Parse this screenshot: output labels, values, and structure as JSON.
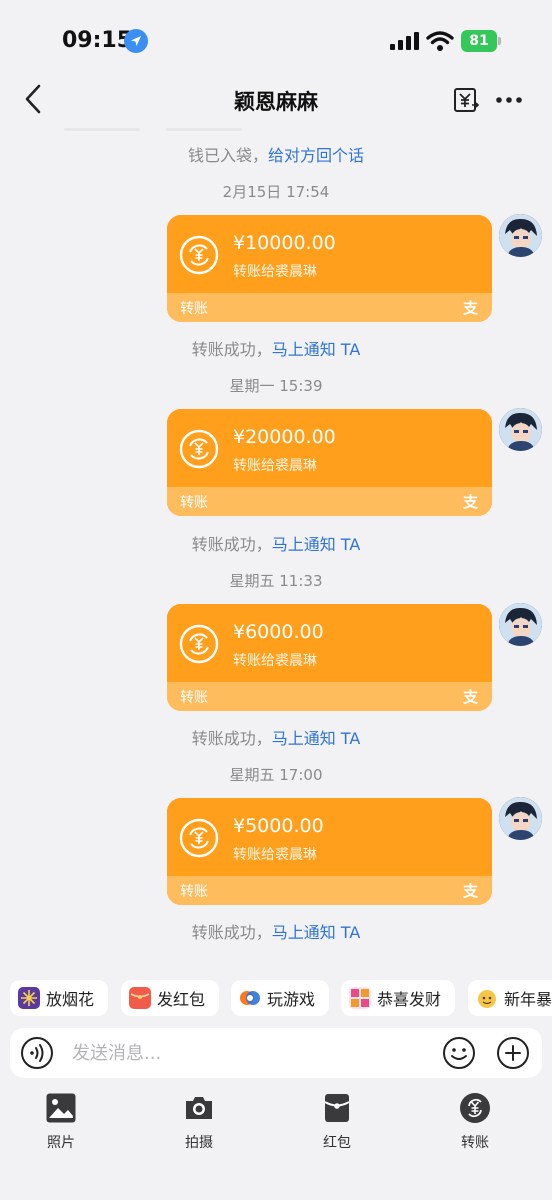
{
  "status_bar": {
    "time": "09:15",
    "battery": "81"
  },
  "nav": {
    "title": "颖恩麻麻"
  },
  "chat": {
    "first_notice": {
      "text": "钱已入袋，",
      "link": "给对方回个话"
    },
    "transfers": [
      {
        "timestamp": "2月15日 17:54",
        "amount": "¥10000.00",
        "desc": "转账给裘晨琳",
        "type": "转账",
        "notice_text": "转账成功，",
        "notice_link": "马上通知 TA"
      },
      {
        "timestamp": "星期一 15:39",
        "amount": "¥20000.00",
        "desc": "转账给裘晨琳",
        "type": "转账",
        "notice_text": "转账成功，",
        "notice_link": "马上通知 TA"
      },
      {
        "timestamp": "星期五 11:33",
        "amount": "¥6000.00",
        "desc": "转账给裘晨琳",
        "type": "转账",
        "notice_text": "转账成功，",
        "notice_link": "马上通知 TA"
      },
      {
        "timestamp": "星期五 17:00",
        "amount": "¥5000.00",
        "desc": "转账给裘晨琳",
        "type": "转账",
        "notice_text": "转账成功，",
        "notice_link": "马上通知 TA"
      }
    ],
    "alipay_mark": "支"
  },
  "quick_actions": [
    {
      "label": "放烟花",
      "icon": "fireworks-icon"
    },
    {
      "label": "发红包",
      "icon": "red-packet-icon"
    },
    {
      "label": "玩游戏",
      "icon": "game-icon"
    },
    {
      "label": "恭喜发财",
      "icon": "fortune-icon"
    },
    {
      "label": "新年暴",
      "icon": "new-year-icon"
    }
  ],
  "input": {
    "placeholder": "发送消息..."
  },
  "toolbar": [
    {
      "label": "照片",
      "icon": "photo-icon"
    },
    {
      "label": "拍摄",
      "icon": "camera-icon"
    },
    {
      "label": "红包",
      "icon": "red-packet-icon"
    },
    {
      "label": "转账",
      "icon": "transfer-icon"
    }
  ],
  "colors": {
    "card_orange": "#ff9f1c",
    "card_footer": "#ffbc5c",
    "link_blue": "#2f74d6"
  }
}
